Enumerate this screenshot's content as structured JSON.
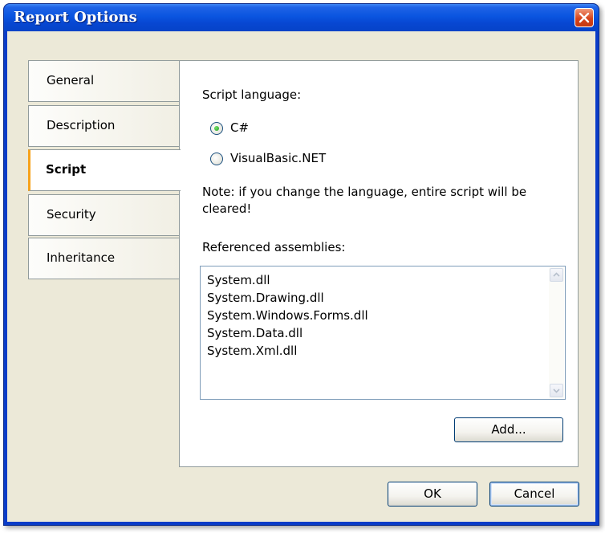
{
  "window": {
    "title": "Report Options"
  },
  "tabs": [
    {
      "label": "General",
      "selected": false
    },
    {
      "label": "Description",
      "selected": false
    },
    {
      "label": "Script",
      "selected": true
    },
    {
      "label": "Security",
      "selected": false
    },
    {
      "label": "Inheritance",
      "selected": false
    }
  ],
  "script": {
    "language_label": "Script language:",
    "options": [
      {
        "label": "C#",
        "checked": true
      },
      {
        "label": "VisualBasic.NET",
        "checked": false
      }
    ],
    "note_line1": "Note: if you change the language, entire script will be",
    "note_line2": "cleared!",
    "assemblies_label": "Referenced assemblies:",
    "assemblies": [
      "System.dll",
      "System.Drawing.dll",
      "System.Windows.Forms.dll",
      "System.Data.dll",
      "System.Xml.dll"
    ],
    "add_button": "Add..."
  },
  "footer": {
    "ok": "OK",
    "cancel": "Cancel"
  },
  "colors": {
    "title_bar": "#0a55e0",
    "selected_tab_accent": "#f7a21a",
    "dialog_bg": "#ece9d8"
  }
}
